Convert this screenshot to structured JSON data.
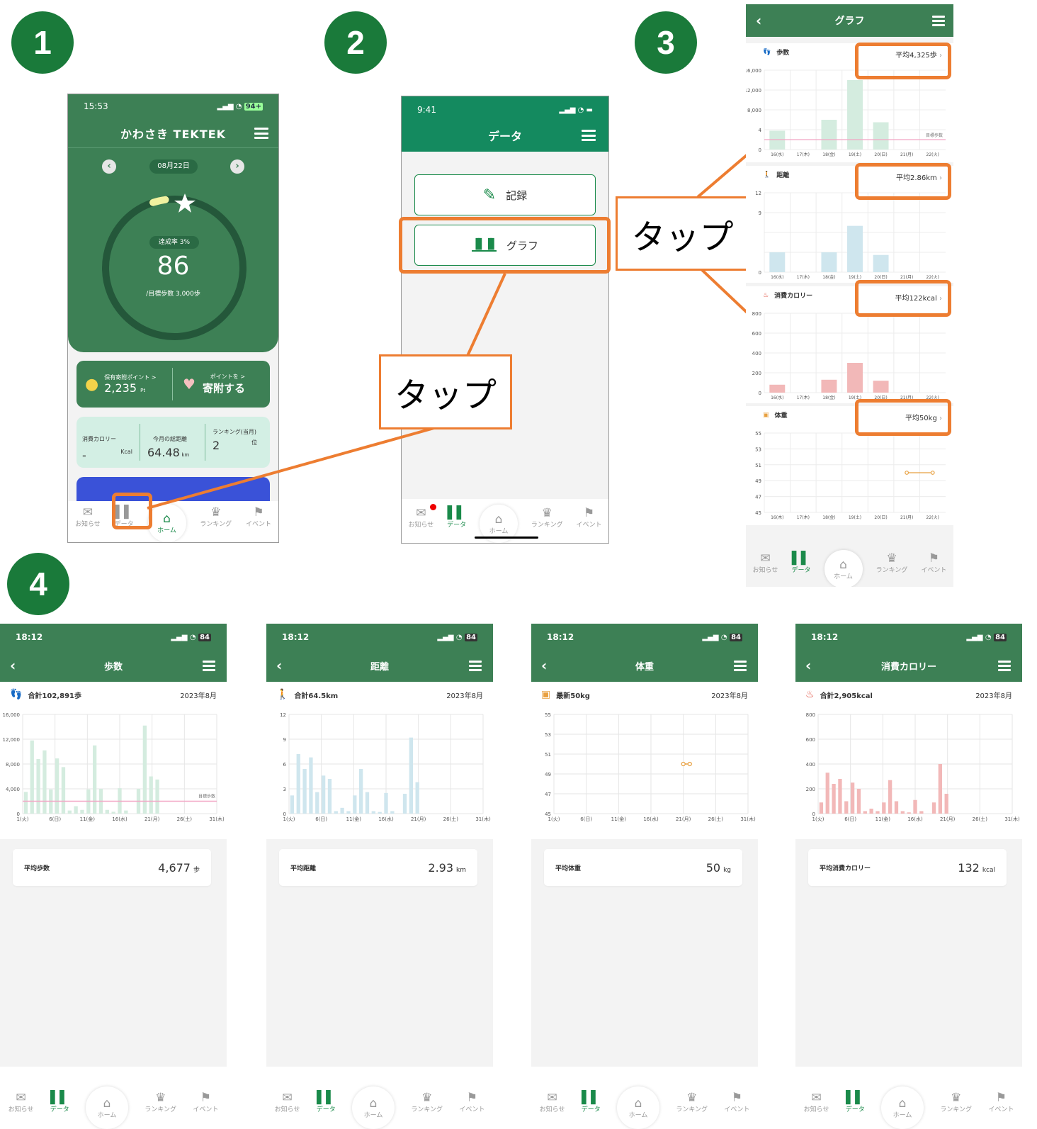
{
  "badges": [
    "1",
    "2",
    "3",
    "4"
  ],
  "tap_label": "タップ",
  "colors": {
    "orange": "#ed7d31",
    "brand_green": "#2e7d50",
    "dark_green": "#1a7a3a",
    "teal": "#148a5f",
    "bar_green": "#d4ecdf",
    "bar_blue": "#cfe6ee",
    "bar_red": "#f2b8b8",
    "goal_line": "#f2a5c4"
  },
  "nav_labels": {
    "news": "お知らせ",
    "data": "データ",
    "home": "ホーム",
    "ranking": "ランキング",
    "event": "イベント"
  },
  "s1": {
    "time": "15:53",
    "battery": "94+",
    "app_title": "かわさき TEKTEK",
    "date": "08月22日",
    "rate_label": "達成率 3%",
    "steps": "86",
    "goal": "/目標歩数 3,000歩",
    "points_label": "保有寄附ポイント >",
    "points_value": "2,235",
    "points_unit": "Pt",
    "donate_label": "ポイントを >",
    "donate_action": "寄附する",
    "cal_label": "消費カロリー",
    "cal_value": "-",
    "cal_unit": "Kcal",
    "dist_label": "今月の総距離",
    "dist_value": "64.48",
    "dist_unit": "km",
    "rank_label": "ランキング(当月)",
    "rank_value": "2",
    "rank_unit": "位",
    "goal_progress": 0.03
  },
  "s2": {
    "time": "9:41",
    "title": "データ",
    "record_label": "記録",
    "graph_label": "グラフ"
  },
  "s3": {
    "title": "グラフ",
    "steps": {
      "label": "歩数",
      "avg": "平均4,325歩",
      "yticks": [
        "16,000",
        "12,000",
        "8,000",
        "4",
        "0"
      ],
      "xticks": [
        "16(水)",
        "17(木)",
        "18(金)",
        "19(土)",
        "20(日)",
        "21(月)",
        "22(火)"
      ],
      "goal": "目標歩数",
      "values": [
        3800,
        0,
        6000,
        14000,
        5500,
        0,
        0
      ]
    },
    "distance": {
      "label": "距離",
      "avg": "平均2.86km",
      "yticks": [
        "12",
        "9",
        "",
        "",
        "0"
      ],
      "xticks": [
        "16(水)",
        "17(木)",
        "18(金)",
        "19(土)",
        "20(日)",
        "21(月)",
        "22(火)"
      ],
      "values": [
        3,
        0,
        3,
        7,
        2.6,
        0,
        0
      ]
    },
    "calorie": {
      "label": "消費カロリー",
      "avg": "平均122kcal",
      "yticks": [
        "800",
        "600",
        "400",
        "200",
        "0"
      ],
      "xticks": [
        "16(水)",
        "17(木)",
        "18(金)",
        "19(土)",
        "20(日)",
        "21(月)",
        "22(火)"
      ],
      "values": [
        80,
        0,
        130,
        300,
        120,
        0,
        0
      ]
    },
    "weight": {
      "label": "体重",
      "avg": "平均50kg",
      "yticks": [
        "55",
        "53",
        "51",
        "49",
        "47",
        "45"
      ],
      "xticks": [
        "16(木)",
        "17(木)",
        "18(金)",
        "19(土)",
        "20(日)",
        "21(月)",
        "22(火)"
      ],
      "points": [
        {
          "x": "21(月)",
          "y": 50
        },
        {
          "x": "22(火)",
          "y": 50
        }
      ]
    }
  },
  "s4": [
    {
      "time": "18:12",
      "battery": "84",
      "title": "歩数",
      "total": "合計102,891歩",
      "month": "2023年8月",
      "avg_label": "平均歩数",
      "avg_value": "4,677",
      "avg_unit": "歩",
      "yticks": [
        "16,000",
        "12,000",
        "8,000",
        "4,000",
        "0"
      ],
      "ymax": 16000,
      "goal": "目標歩数",
      "goal_value": 2000,
      "color": "#d4ecdf",
      "xticks": [
        "1(火)",
        "6(日)",
        "11(金)",
        "16(水)",
        "21(月)",
        "26(土)",
        "31(木)"
      ],
      "values": [
        3500,
        11800,
        8800,
        10200,
        3900,
        8900,
        7500,
        500,
        1200,
        600,
        3900,
        11000,
        4000,
        600,
        300,
        4100,
        500,
        0,
        4000,
        14200,
        6000,
        5500,
        0,
        0,
        0,
        0,
        0,
        0,
        0,
        0,
        0
      ]
    },
    {
      "time": "18:12",
      "battery": "84",
      "title": "距離",
      "total": "合計64.5km",
      "month": "2023年8月",
      "avg_label": "平均距離",
      "avg_value": "2.93",
      "avg_unit": "km",
      "yticks": [
        "12",
        "9",
        "6",
        "3",
        "0"
      ],
      "ymax": 12,
      "color": "#cfe6ee",
      "xticks": [
        "1(火)",
        "6(日)",
        "11(金)",
        "16(水)",
        "21(月)",
        "26(土)",
        "31(木)"
      ],
      "values": [
        2.2,
        7.2,
        5.4,
        6.8,
        2.6,
        4.6,
        4.2,
        0.3,
        0.7,
        0.3,
        2.2,
        5.4,
        2.6,
        0.3,
        0.2,
        2.5,
        0.3,
        0,
        2.4,
        9.2,
        3.8,
        0,
        0,
        0,
        0,
        0,
        0,
        0,
        0,
        0,
        0
      ]
    },
    {
      "time": "18:12",
      "battery": "84",
      "title": "体重",
      "total": "最新50kg",
      "month": "2023年8月",
      "avg_label": "平均体重",
      "avg_value": "50",
      "avg_unit": "kg",
      "yticks": [
        "55",
        "53",
        "51",
        "49",
        "47",
        "45"
      ],
      "ymin": 45,
      "ymax": 55,
      "color": "#e8a040",
      "xticks": [
        "1(火)",
        "6(日)",
        "11(金)",
        "16(水)",
        "21(月)",
        "26(土)",
        "31(木)"
      ],
      "points": [
        {
          "day": 21,
          "y": 50
        },
        {
          "day": 22,
          "y": 50
        }
      ]
    },
    {
      "time": "18:12",
      "battery": "84",
      "title": "消費カロリー",
      "total": "合計2,905kcal",
      "month": "2023年8月",
      "avg_label": "平均消費カロリー",
      "avg_value": "132",
      "avg_unit": "kcal",
      "yticks": [
        "800",
        "600",
        "400",
        "200",
        "0"
      ],
      "ymax": 800,
      "color": "#f2b8b8",
      "xticks": [
        "1(火)",
        "6(日)",
        "11(金)",
        "16(水)",
        "21(月)",
        "26(土)",
        "31(木)"
      ],
      "values": [
        90,
        330,
        240,
        280,
        100,
        250,
        200,
        20,
        40,
        20,
        90,
        270,
        100,
        20,
        10,
        110,
        20,
        0,
        90,
        400,
        160,
        0,
        0,
        0,
        0,
        0,
        0,
        0,
        0,
        0,
        0
      ]
    }
  ]
}
